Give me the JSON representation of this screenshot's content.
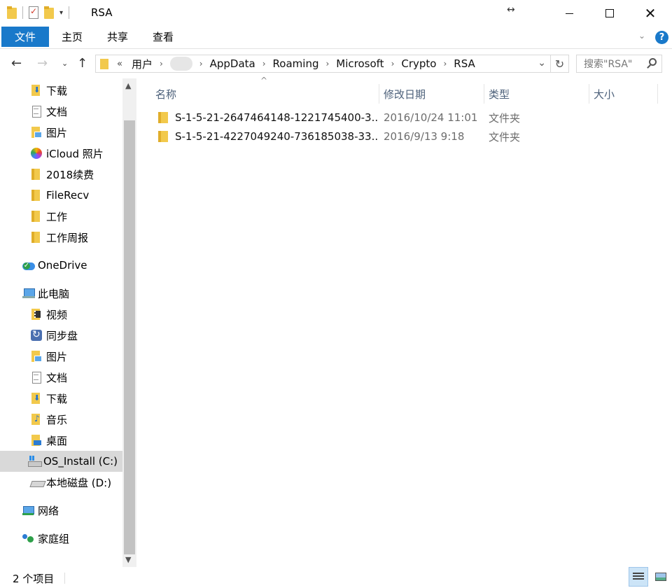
{
  "window": {
    "title": "RSA",
    "qat_arrow": "▾",
    "resize_hint": "↔",
    "close": "✕"
  },
  "ribbon": {
    "tabs": [
      "文件",
      "主页",
      "共享",
      "查看"
    ],
    "collapse_glyph": "⌄",
    "help": "?"
  },
  "nav": {
    "back": "←",
    "forward": "→",
    "recent": "⌄",
    "up": "↑"
  },
  "address": {
    "overflow": "«",
    "crumbs": [
      "用户",
      "AppData",
      "Roaming",
      "Microsoft",
      "Crypto",
      "RSA"
    ],
    "separator": "›",
    "dropdown": "⌄",
    "refresh": "↻"
  },
  "search": {
    "placeholder": "搜索\"RSA\""
  },
  "navpane": {
    "items": [
      {
        "label": "下载",
        "icon": "download-folder-icon",
        "pinned": true
      },
      {
        "label": "文档",
        "icon": "documents-icon",
        "pinned": true
      },
      {
        "label": "图片",
        "icon": "pictures-icon",
        "pinned": true
      },
      {
        "label": "iCloud 照片",
        "icon": "icloud-photos-icon",
        "pinned": true
      },
      {
        "label": "2018续费",
        "icon": "folder-icon"
      },
      {
        "label": "FileRecv",
        "icon": "folder-icon"
      },
      {
        "label": "工作",
        "icon": "folder-icon"
      },
      {
        "label": "工作周报",
        "icon": "folder-icon"
      },
      {
        "label": "OneDrive",
        "icon": "onedrive-icon"
      },
      {
        "label": "此电脑",
        "icon": "this-pc-icon"
      },
      {
        "label": "视频",
        "icon": "videos-icon"
      },
      {
        "label": "同步盘",
        "icon": "sync-drive-icon"
      },
      {
        "label": "图片",
        "icon": "pictures-icon"
      },
      {
        "label": "文档",
        "icon": "documents-icon"
      },
      {
        "label": "下载",
        "icon": "download-folder-icon"
      },
      {
        "label": "音乐",
        "icon": "music-icon"
      },
      {
        "label": "桌面",
        "icon": "desktop-icon"
      },
      {
        "label": "OS_Install (C:)",
        "icon": "os-drive-icon",
        "selected": true
      },
      {
        "label": "本地磁盘 (D:)",
        "icon": "local-disk-icon"
      },
      {
        "label": "网络",
        "icon": "network-icon"
      },
      {
        "label": "家庭组",
        "icon": "homegroup-icon"
      }
    ],
    "pin_glyph": "📌",
    "scroll_up": "▲",
    "scroll_down": "▼"
  },
  "columns": {
    "sort_caret": "^",
    "name": "名称",
    "date": "修改日期",
    "type": "类型",
    "size": "大小"
  },
  "files": [
    {
      "name": "S-1-5-21-2647464148-1221745400-3...",
      "date": "2016/10/24 11:01",
      "type": "文件夹"
    },
    {
      "name": "S-1-5-21-4227049240-736185038-33...",
      "date": "2016/9/13 9:18",
      "type": "文件夹"
    }
  ],
  "status": {
    "count": "2 个项目"
  }
}
